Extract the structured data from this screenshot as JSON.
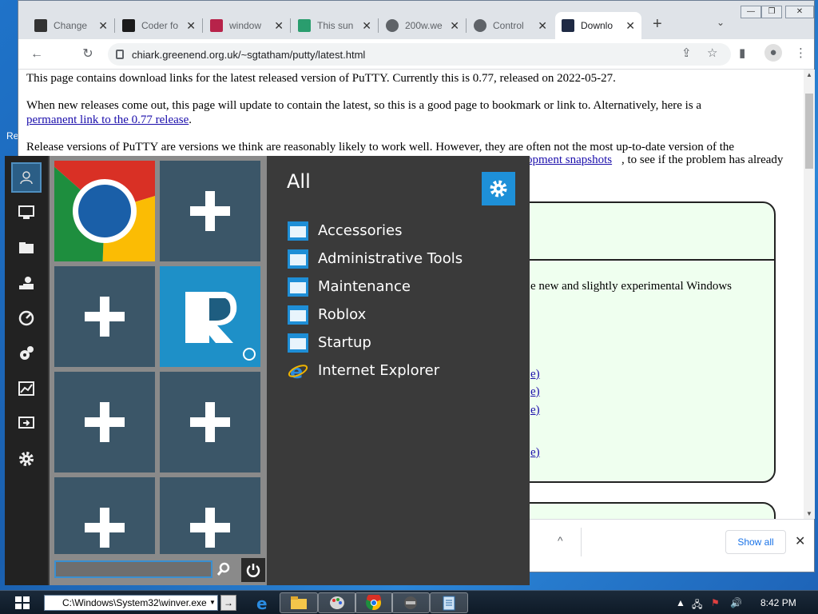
{
  "desktop": {
    "edge_text": "Re"
  },
  "browser": {
    "tabs": [
      {
        "title": "Change",
        "fav_color": "#333333"
      },
      {
        "title": "Coder fo",
        "fav_color": "#1b1b1b"
      },
      {
        "title": "window",
        "fav_color": "#b7234a"
      },
      {
        "title": "This sun",
        "fav_color": "#2a9d6e"
      },
      {
        "title": "200w.we",
        "fav_color": "#5f6368"
      },
      {
        "title": "Control",
        "fav_color": "#5f6368"
      },
      {
        "title": "Downlo",
        "fav_color": "#1f2a44"
      }
    ],
    "new_tab_label": "+",
    "tab_menu_label": "⌄",
    "url": "chiark.greenend.org.uk/~sgtatham/putty/latest.html",
    "page": {
      "para1": "This page contains download links for the latest released version of PuTTY. Currently this is 0.77, released on 2022-05-27.",
      "para2_text": "When new releases come out, this page will update to contain the latest, so this is a good page to bookmark or link to. Alternatively, here is a",
      "para2_link": "permanent link to the 0.77 release",
      "para2_end": ".",
      "para3": "Release versions of PuTTY are versions we think are reasonably likely to work well. However, they are often not the most up-to-date version of the",
      "frag_dev_link": "opment snapshots",
      "frag_dev_text": ", to see if the problem has already",
      "frag_experimental": "e new and slightly experimental Windows",
      "frag_links": [
        "e)",
        "e)",
        "e)",
        "e)"
      ]
    },
    "download_bar": {
      "show_all": "Show all",
      "close": "✕",
      "chevron": "^"
    }
  },
  "start_menu": {
    "heading": "All",
    "items": [
      {
        "label": "Accessories",
        "icon": "folder-icon"
      },
      {
        "label": "Administrative Tools",
        "icon": "folder-icon"
      },
      {
        "label": "Maintenance",
        "icon": "folder-icon"
      },
      {
        "label": "Roblox",
        "icon": "folder-icon"
      },
      {
        "label": "Startup",
        "icon": "folder-icon"
      },
      {
        "label": "Internet Explorer",
        "icon": "ie-icon"
      }
    ],
    "strip_icons": [
      "user-icon",
      "computer-icon",
      "folder-icon",
      "users-icon",
      "dashboard-icon",
      "gears-icon",
      "chart-icon",
      "display-icon",
      "settings-icon"
    ]
  },
  "taskbar": {
    "run_path": "C:\\Windows\\System32\\winver.exe",
    "go_label": "→",
    "clock": "8:42 PM"
  }
}
